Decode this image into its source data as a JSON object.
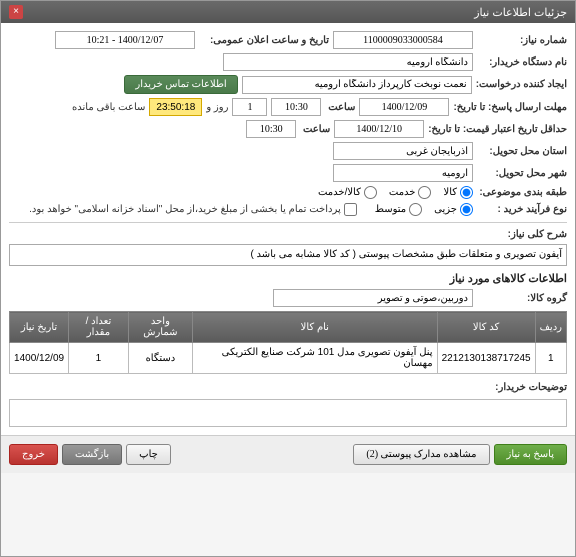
{
  "window": {
    "title": "جزئیات اطلاعات نیاز"
  },
  "fields": {
    "need_no_label": "شماره نیاز:",
    "need_no": "1100009033000584",
    "pub_date_label": "تاریخ و ساعت اعلان عمومی:",
    "pub_date": "1400/12/07 - 10:21",
    "buyer_label": "نام دستگاه خریدار:",
    "buyer": "دانشگاه ارومیه",
    "requester_label": "ایجاد کننده درخواست:",
    "requester": "نعمت نوبخت کارپرداز دانشگاه ارومیه",
    "contact_btn": "اطلاعات تماس خریدار",
    "deadline_label": "مهلت ارسال پاسخ: تا تاریخ:",
    "deadline_date": "1400/12/09",
    "hour_label": "ساعت",
    "deadline_hour": "10:30",
    "day_and": "روز و",
    "days_remain": "1",
    "time_remain": "23:50:18",
    "remain_text": "ساعت باقی مانده",
    "validity_label": "حداقل تاریخ اعتبار قیمت: تا تاریخ:",
    "validity_date": "1400/12/10",
    "validity_hour": "10:30",
    "province_label": "استان محل تحویل:",
    "province": "آذربایجان غربی",
    "city_label": "شهر محل تحویل:",
    "city": "ارومیه",
    "subject_class_label": "طبقه بندی موضوعی:",
    "radio_kala": "کالا",
    "radio_service": "خدمت",
    "radio_both": "کالا/خدمت",
    "process_label": "نوع فرآیند خرید :",
    "radio_partial": "جزیی",
    "radio_medium": "متوسط",
    "checkbox_note": "پرداخت تمام یا بخشی از مبلغ خرید،از محل \"اسناد خزانه اسلامی\" خواهد بود.",
    "desc_label": "شرح کلی نیاز:",
    "desc_value": "آیفون تصویری و متعلقات طبق مشخصات پیوستی ( کد کالا مشابه می باشد )",
    "items_title": "اطلاعات کالاهای مورد نیاز",
    "group_label": "گروه کالا:",
    "group_value": "دوربین،صوتی و تصویر",
    "buyer_notes_label": "توضیحات خریدار:"
  },
  "table": {
    "headers": {
      "row": "ردیف",
      "code": "کد کالا",
      "name": "نام کالا",
      "unit": "واحد شمارش",
      "qty": "تعداد / مقدار",
      "date": "تاریخ نیاز"
    },
    "rows": [
      {
        "row": "1",
        "code": "2212130138717245",
        "name": "پنل آیفون تصویری مدل 101 شرکت صنایع الکتریکی مهسان",
        "unit": "دستگاه",
        "qty": "1",
        "date": "1400/12/09"
      }
    ]
  },
  "buttons": {
    "exit": "خروج",
    "return": "بازگشت",
    "print": "چاپ",
    "attachments": "مشاهده مدارک پیوستی (2)",
    "respond": "پاسخ به نیاز"
  }
}
